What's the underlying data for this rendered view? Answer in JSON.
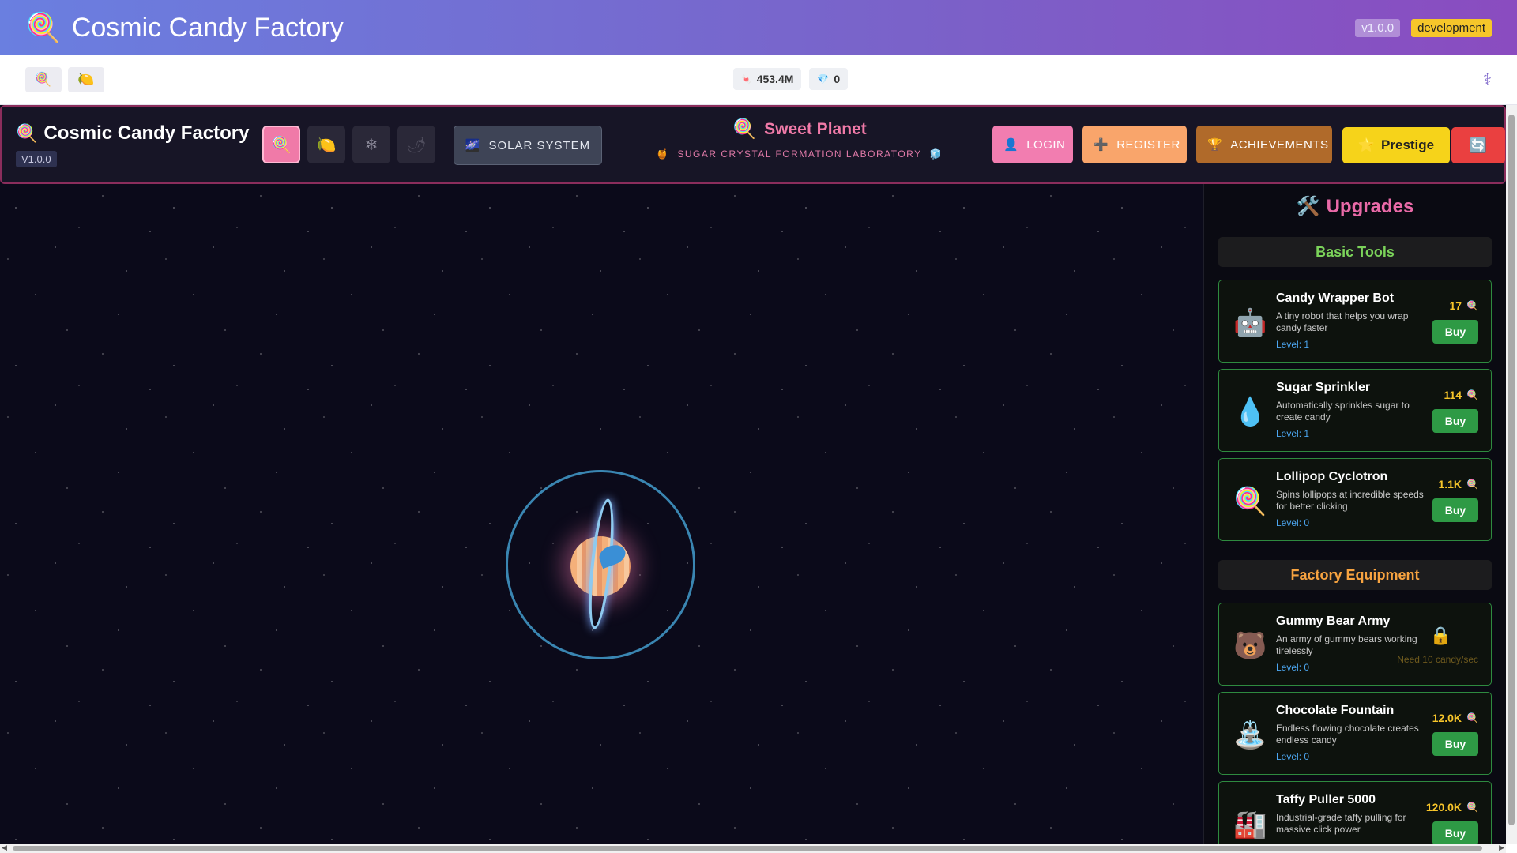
{
  "app_header": {
    "title": "Cosmic Candy Factory",
    "logo_icon": "🍭",
    "version": "v1.0.0",
    "environment": "development"
  },
  "toolbar": {
    "buttons": [
      {
        "icon": "🍭"
      },
      {
        "icon": "🍋"
      }
    ],
    "candy_count": "453.4M",
    "candy_icon": "🍬",
    "gem_count": "0",
    "gem_icon": "💎",
    "menu_icon": "⚕"
  },
  "game_header": {
    "brand_icon": "🍭",
    "brand": "Cosmic Candy Factory",
    "version": "V1.0.0",
    "planet_tabs": [
      {
        "icon": "🍭"
      },
      {
        "icon": "🍋"
      },
      {
        "icon": "❄"
      },
      {
        "icon": "🌶"
      }
    ],
    "solar_system_icon": "🌌",
    "solar_system": "SOLAR SYSTEM",
    "planet_icon": "🍭",
    "planet_name": "Sweet Planet",
    "lab_left_icon": "🍯",
    "lab_right_icon": "🧊",
    "lab_name": "SUGAR CRYSTAL FORMATION LABORATORY",
    "login_icon": "👤",
    "login": "LOGIN",
    "register_icon": "➕",
    "register": "REGISTER",
    "achievements_icon": "🏆",
    "achievements": "ACHIEVEMENTS",
    "prestige_icon": "⭐",
    "prestige": "Prestige",
    "refresh_icon": "🔄"
  },
  "upgrades": {
    "title_icon": "🛠️",
    "title": "Upgrades",
    "sections": [
      {
        "title": "Basic Tools",
        "items": [
          {
            "icon": "🤖",
            "name": "Candy Wrapper Bot",
            "desc": "A tiny robot that helps you wrap candy faster",
            "level": "Level: 1",
            "price": "17",
            "buy": "Buy"
          },
          {
            "icon": "💧",
            "name": "Sugar Sprinkler",
            "desc": "Automatically sprinkles sugar to create candy",
            "level": "Level: 1",
            "price": "114",
            "buy": "Buy"
          },
          {
            "icon": "🍭",
            "name": "Lollipop Cyclotron",
            "desc": "Spins lollipops at incredible speeds for better clicking",
            "level": "Level: 0",
            "price": "1.1K",
            "buy": "Buy"
          }
        ]
      },
      {
        "title": "Factory Equipment",
        "items": [
          {
            "icon": "🐻",
            "name": "Gummy Bear Army",
            "desc": "An army of gummy bears working tirelessly",
            "level": "Level: 0",
            "locked": "🔒",
            "requirement": "Need 10 candy/sec"
          },
          {
            "icon": "⛲",
            "name": "Chocolate Fountain",
            "desc": "Endless flowing chocolate creates endless candy",
            "level": "Level: 0",
            "price": "12.0K",
            "buy": "Buy"
          },
          {
            "icon": "🏭",
            "name": "Taffy Puller 5000",
            "desc": "Industrial-grade taffy pulling for massive click power",
            "level": "",
            "price": "120.0K",
            "buy": "Buy"
          }
        ]
      }
    ],
    "price_icon": "🍭"
  },
  "colors": {
    "header_gradient_start": "#6a7fe0",
    "header_gradient_end": "#8a4cc0",
    "accent_pink": "#f07aa8",
    "buy_green": "#2e9a45",
    "price_gold": "#f7c52a"
  }
}
